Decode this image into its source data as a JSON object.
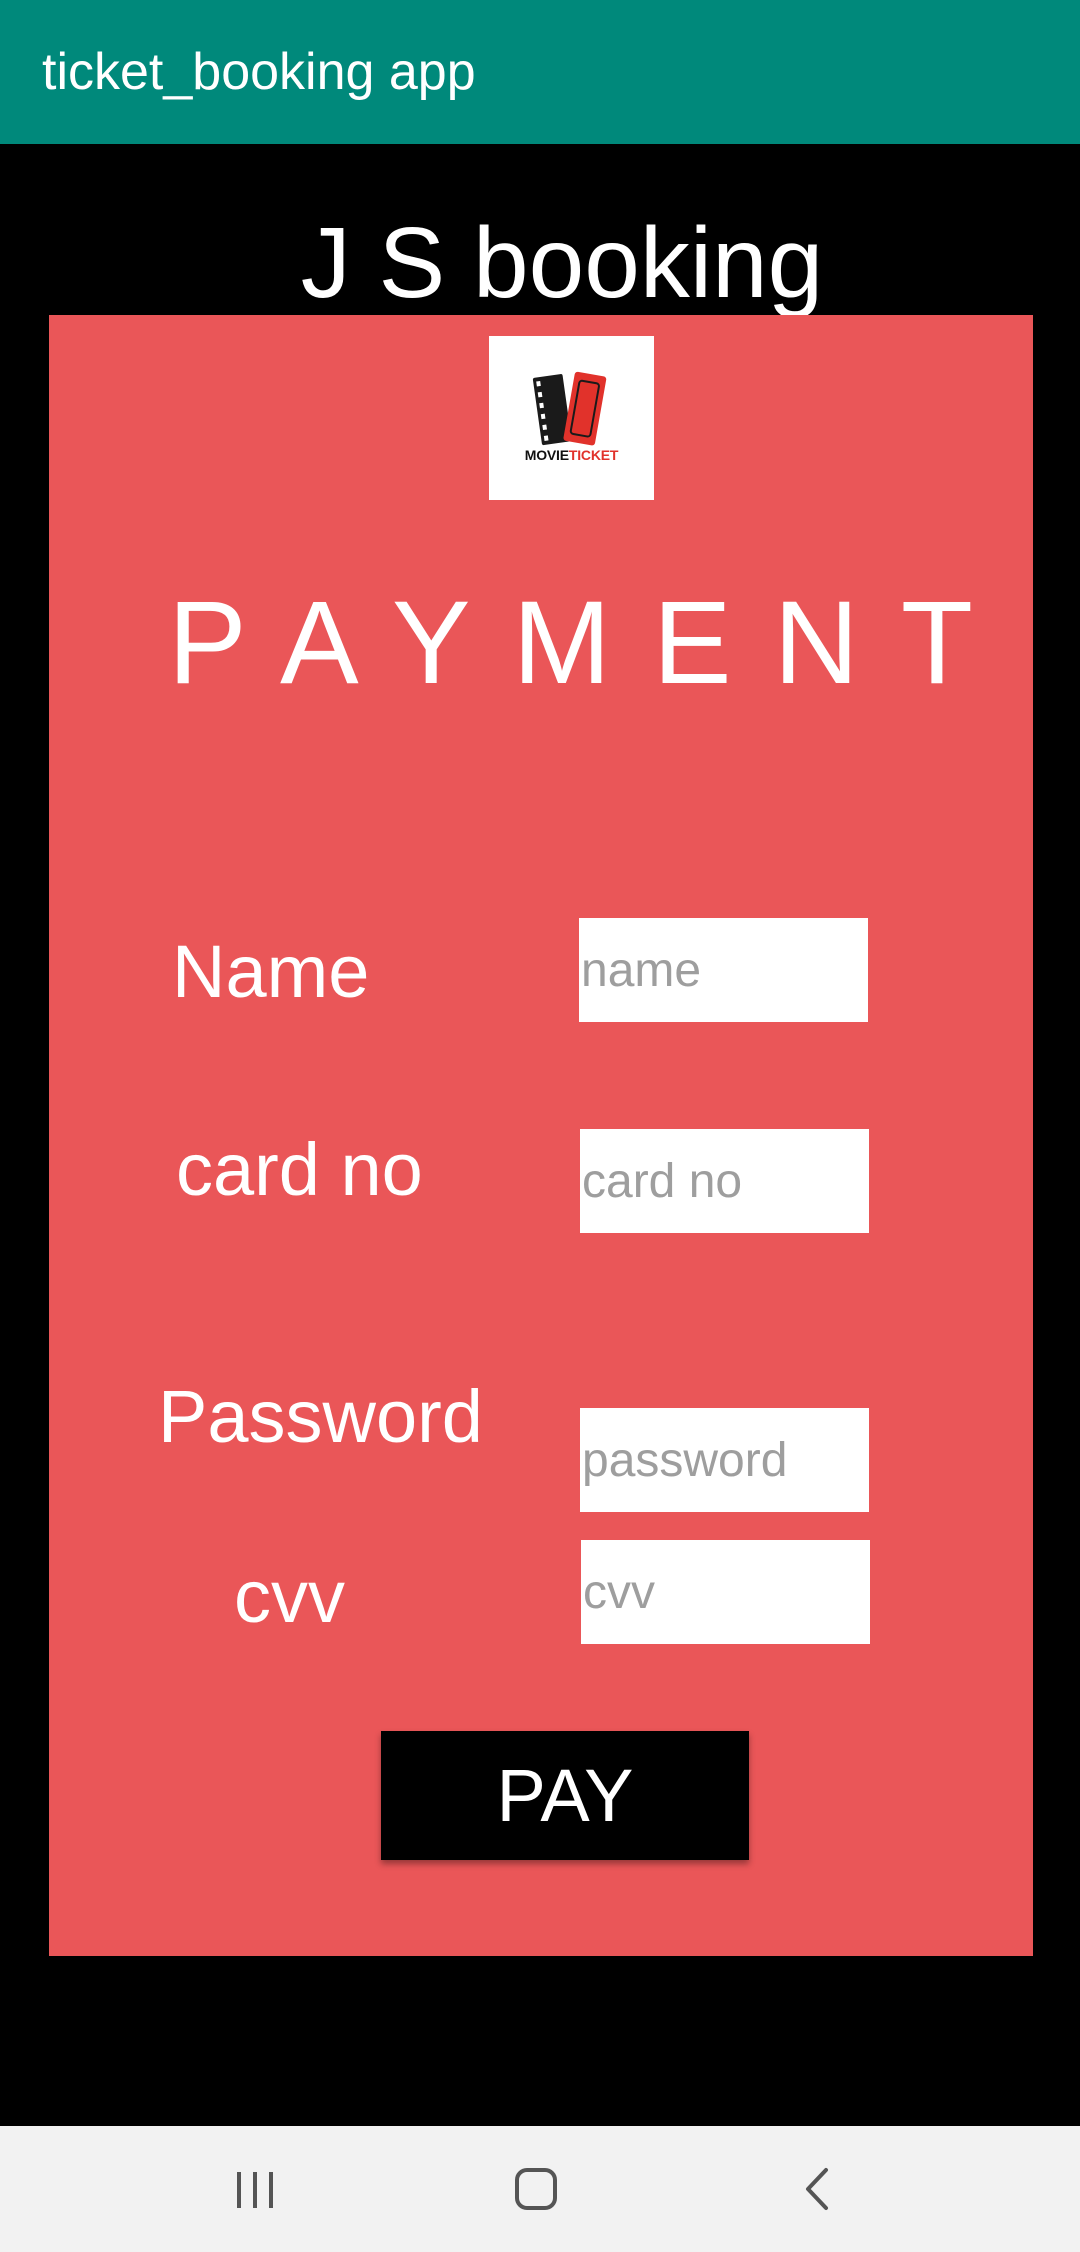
{
  "app_bar": {
    "title": "ticket_booking app",
    "color": "#00897B"
  },
  "heading": "J S booking",
  "logo": {
    "icon": "movie-ticket-icon",
    "word1": "MOVIE",
    "word2": "TICKET"
  },
  "payment": {
    "title": "PAYMENT",
    "card_color": "#EA5658"
  },
  "form": {
    "name": {
      "label": "Name",
      "placeholder": "name",
      "value": ""
    },
    "card_no": {
      "label": "card no",
      "placeholder": "card no",
      "value": ""
    },
    "password": {
      "label": "Password",
      "placeholder": "password",
      "value": ""
    },
    "cvv": {
      "label": "cvv",
      "placeholder": "cvv",
      "value": ""
    }
  },
  "pay_button": {
    "label": "PAY"
  },
  "nav_bar": {
    "recents": "recents-icon",
    "home": "home-icon",
    "back": "back-icon"
  }
}
